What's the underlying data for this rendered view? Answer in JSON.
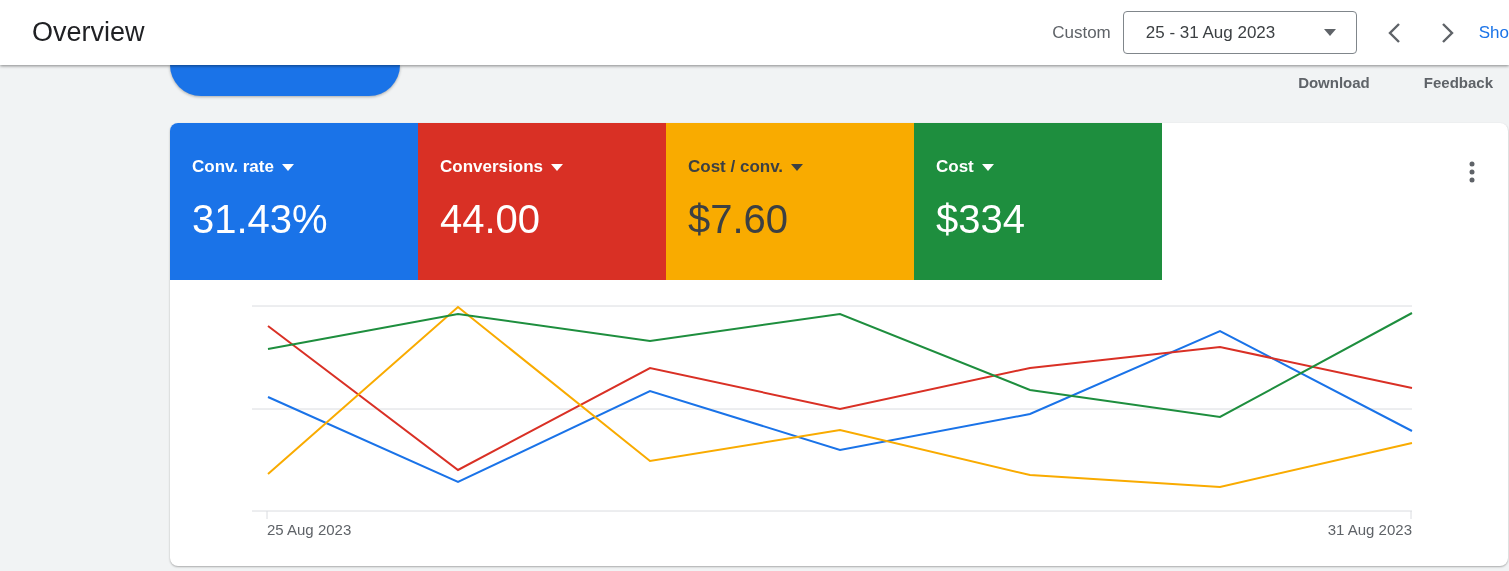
{
  "header": {
    "title": "Overview",
    "range_label": "Custom",
    "date_range": "25 - 31 Aug 2023",
    "show_link": "Sho"
  },
  "actions": [
    "Download",
    "Feedback"
  ],
  "metrics": [
    {
      "label": "Conv. rate",
      "value": "31.43%",
      "color": "#1a73e8"
    },
    {
      "label": "Conversions",
      "value": "44.00",
      "color": "#d93025"
    },
    {
      "label": "Cost / conv.",
      "value": "$7.60",
      "color": "#f9ab00"
    },
    {
      "label": "Cost",
      "value": "$334",
      "color": "#1e8e3e"
    }
  ],
  "x_labels": [
    "25 Aug 2023",
    "31 Aug 2023"
  ]
}
